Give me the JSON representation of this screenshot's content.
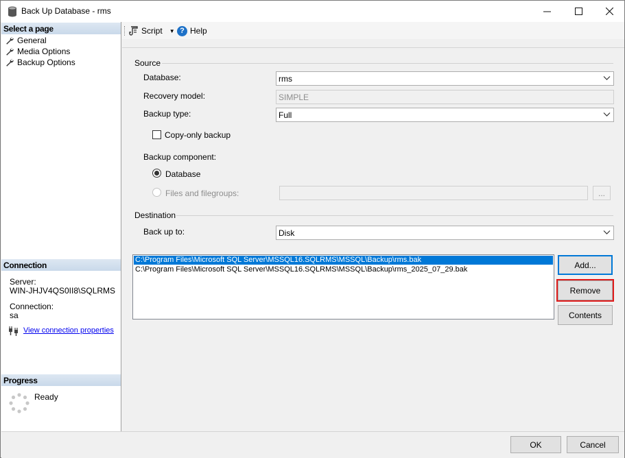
{
  "window": {
    "title": "Back Up Database - rms",
    "minimize_icon": "minimize-icon",
    "maximize_icon": "maximize-icon",
    "close_icon": "close-icon"
  },
  "left_panel": {
    "select_page_header": "Select a page",
    "pages": [
      {
        "label": "General",
        "icon": "wrench-icon",
        "selected": true
      },
      {
        "label": "Media Options",
        "icon": "wrench-icon",
        "selected": false
      },
      {
        "label": "Backup Options",
        "icon": "wrench-icon",
        "selected": false
      }
    ],
    "connection_header": "Connection",
    "server_label": "Server:",
    "server_value": "WIN-JHJV4QS0II8\\SQLRMS",
    "connection_label": "Connection:",
    "connection_value": "sa",
    "view_connection_link": "View connection properties",
    "progress_header": "Progress",
    "progress_status": "Ready"
  },
  "toolbar": {
    "script_label": "Script",
    "help_label": "Help"
  },
  "source": {
    "group_title": "Source",
    "database_label": "Database:",
    "database_value": "rms",
    "recovery_label": "Recovery model:",
    "recovery_value": "SIMPLE",
    "backup_type_label": "Backup type:",
    "backup_type_value": "Full",
    "copy_only_label": "Copy-only backup",
    "copy_only_checked": false,
    "component_label": "Backup component:",
    "component_database_label": "Database",
    "component_files_label": "Files and filegroups:",
    "files_browse_label": "..."
  },
  "destination": {
    "group_title": "Destination",
    "backup_to_label": "Back up to:",
    "backup_to_value": "Disk",
    "files": [
      "C:\\Program Files\\Microsoft SQL Server\\MSSQL16.SQLRMS\\MSSQL\\Backup\\rms.bak",
      "C:\\Program Files\\Microsoft SQL Server\\MSSQL16.SQLRMS\\MSSQL\\Backup\\rms_2025_07_29.bak"
    ],
    "add_label": "Add...",
    "remove_label": "Remove",
    "contents_label": "Contents"
  },
  "footer": {
    "ok_label": "OK",
    "cancel_label": "Cancel"
  }
}
